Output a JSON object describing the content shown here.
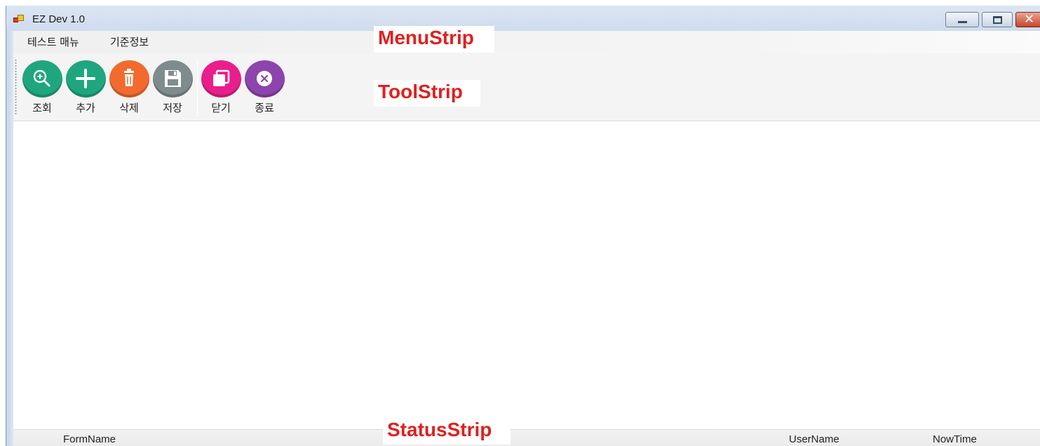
{
  "window": {
    "title": "EZ Dev 1.0",
    "app_icon": "windows-app-icon",
    "controls": [
      "minimize-icon",
      "maximize-icon",
      "close-icon"
    ]
  },
  "menustrip": {
    "items": [
      {
        "label": "테스트 매뉴"
      },
      {
        "label": "기준정보"
      }
    ]
  },
  "toolstrip": {
    "buttons": [
      {
        "label": "조회",
        "icon": "search-zoom-icon",
        "color": "#1fa67f"
      },
      {
        "label": "추가",
        "icon": "plus-icon",
        "color": "#1fa67f"
      },
      {
        "label": "삭제",
        "icon": "trash-icon",
        "color": "#f26a2e"
      },
      {
        "label": "저장",
        "icon": "save-icon",
        "color": "#7f8c8d"
      },
      {
        "label": "닫기",
        "icon": "window-close-icon",
        "color": "#e91e8c"
      },
      {
        "label": "종료",
        "icon": "exit-icon",
        "color": "#8e44ad"
      }
    ]
  },
  "statusstrip": {
    "form_name": "FormName",
    "user_name": "UserName",
    "now_time": "NowTime"
  },
  "annotations": {
    "menustrip": "MenuStrip",
    "toolstrip": "ToolStrip",
    "statusstrip": "StatusStrip",
    "color": "#e02020"
  }
}
